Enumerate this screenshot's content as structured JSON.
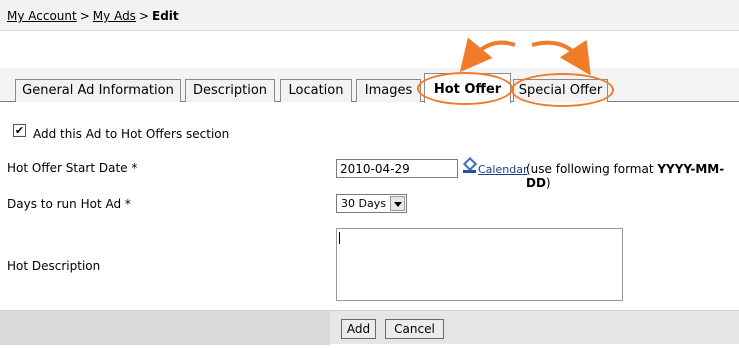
{
  "breadcrumb": {
    "my_account": "My Account",
    "sep1": ">",
    "my_ads": "My Ads",
    "sep2": ">",
    "current": "Edit"
  },
  "tabs": [
    {
      "label": "General Ad Information"
    },
    {
      "label": "Description"
    },
    {
      "label": "Location"
    },
    {
      "label": "Images"
    },
    {
      "label": "Hot Offer",
      "active": true
    },
    {
      "label": "Special Offer"
    }
  ],
  "form": {
    "add_hot_offer_checked": true,
    "add_hot_offer_label": "Add this Ad to Hot Offers section",
    "start_date_label": "Hot Offer Start Date *",
    "start_date_value": "2010-04-29",
    "calendar_link": "Calendar",
    "format_prefix": "(use following format ",
    "format_value": "YYYY-MM-DD",
    "format_suffix": ")",
    "days_label": "Days to run Hot Ad *",
    "days_value": "30 Days",
    "description_label": "Hot Description",
    "description_value": ""
  },
  "buttons": {
    "add": "Add",
    "cancel": "Cancel"
  },
  "colors": {
    "highlight": "#f07b28",
    "link": "#1a3d8f"
  },
  "icons": {
    "calendar": "calendar-icon",
    "checkmark": "checkmark-icon"
  }
}
